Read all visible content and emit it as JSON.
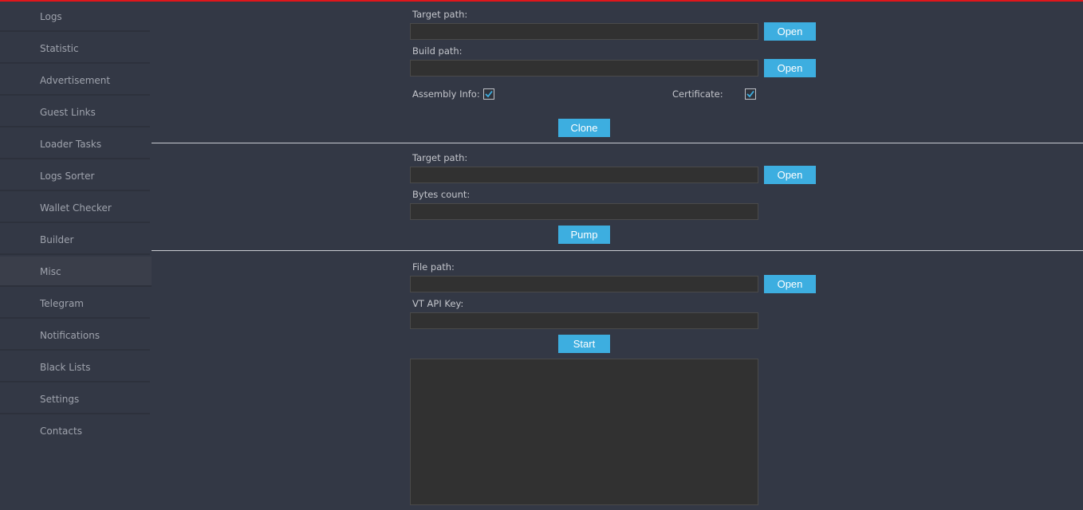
{
  "colors": {
    "background": "#333845",
    "accent": "#3daee0",
    "top_bar": "#e0161b",
    "input_bg": "#313131"
  },
  "sidebar": {
    "items": [
      {
        "label": "Logs"
      },
      {
        "label": "Statistic"
      },
      {
        "label": "Advertisement"
      },
      {
        "label": "Guest Links"
      },
      {
        "label": "Loader Tasks"
      },
      {
        "label": "Logs Sorter"
      },
      {
        "label": "Wallet Checker"
      },
      {
        "label": "Builder"
      },
      {
        "label": "Misc"
      },
      {
        "label": "Telegram"
      },
      {
        "label": "Notifications"
      },
      {
        "label": "Black Lists"
      },
      {
        "label": "Settings"
      },
      {
        "label": "Contacts"
      }
    ],
    "active": "Misc"
  },
  "clone_section": {
    "target_path_label": "Target path:",
    "target_path_value": "",
    "build_path_label": "Build path:",
    "build_path_value": "",
    "open_label": "Open",
    "assembly_info_label": "Assembly Info:",
    "assembly_info_checked": true,
    "certificate_label": "Certificate:",
    "certificate_checked": true,
    "clone_label": "Clone"
  },
  "pump_section": {
    "target_path_label": "Target path:",
    "target_path_value": "",
    "open_label": "Open",
    "bytes_count_label": "Bytes count:",
    "bytes_count_value": "",
    "pump_label": "Pump"
  },
  "scan_section": {
    "file_path_label": "File path:",
    "file_path_value": "",
    "open_label": "Open",
    "vt_api_key_label": "VT API Key:",
    "vt_api_key_value": "",
    "start_label": "Start",
    "output_text": ""
  }
}
